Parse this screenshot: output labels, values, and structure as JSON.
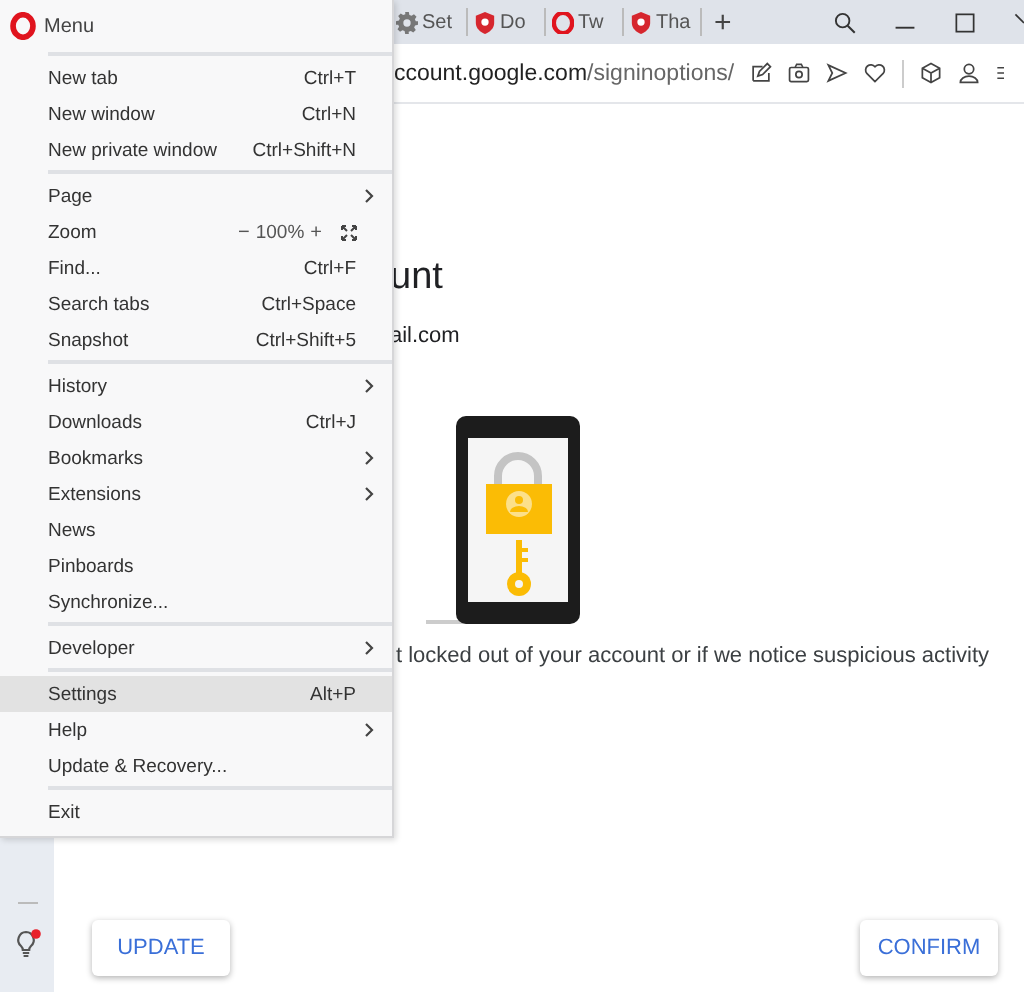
{
  "tabs": [
    {
      "kind": "gear",
      "label": "Set",
      "selected": false
    },
    {
      "kind": "shield",
      "label": "Do",
      "selected": false
    },
    {
      "kind": "opera",
      "label": "Tw",
      "selected": false
    },
    {
      "kind": "shield",
      "label": "Tha",
      "selected": false
    }
  ],
  "new_tab": "+",
  "address_bar": {
    "host": "ccount.google.com",
    "path": "/signinoptions/"
  },
  "page": {
    "heading": "unt",
    "email": "ail.com",
    "description": "t locked out of your account or if we notice suspicious activity",
    "buttons": [
      "UPDATE",
      "CONFIRM"
    ]
  },
  "sidebar": {
    "notification": true
  },
  "menu": {
    "title": "Menu",
    "groups": [
      [
        {
          "kind": "item",
          "label": "New tab",
          "shortcut": "Ctrl+T",
          "selected": false
        },
        {
          "kind": "item",
          "label": "New window",
          "shortcut": "Ctrl+N",
          "selected": false
        },
        {
          "kind": "item",
          "label": "New private window",
          "shortcut": "Ctrl+Shift+N",
          "selected": false
        }
      ],
      [
        {
          "kind": "submenu",
          "label": "Page",
          "selected": false
        },
        {
          "kind": "zoom",
          "label": "Zoom",
          "minus": "−",
          "value": "100%",
          "plus": "+",
          "selected": false
        },
        {
          "kind": "item",
          "label": "Find...",
          "shortcut": "Ctrl+F",
          "selected": false
        },
        {
          "kind": "item",
          "label": "Search tabs",
          "shortcut": "Ctrl+Space",
          "selected": false
        },
        {
          "kind": "item",
          "label": "Snapshot",
          "shortcut": "Ctrl+Shift+5",
          "selected": false
        }
      ],
      [
        {
          "kind": "submenu",
          "label": "History",
          "selected": false
        },
        {
          "kind": "item",
          "label": "Downloads",
          "shortcut": "Ctrl+J",
          "selected": false
        },
        {
          "kind": "submenu",
          "label": "Bookmarks",
          "selected": false
        },
        {
          "kind": "submenu",
          "label": "Extensions",
          "selected": false
        },
        {
          "kind": "item",
          "label": "News",
          "selected": false
        },
        {
          "kind": "item",
          "label": "Pinboards",
          "selected": false
        },
        {
          "kind": "item",
          "label": "Synchronize...",
          "selected": false
        }
      ],
      [
        {
          "kind": "submenu",
          "label": "Developer",
          "selected": false
        }
      ],
      [
        {
          "kind": "item",
          "label": "Settings",
          "shortcut": "Alt+P",
          "selected": true
        },
        {
          "kind": "submenu",
          "label": "Help",
          "selected": false
        },
        {
          "kind": "item",
          "label": "Update & Recovery...",
          "selected": false
        }
      ],
      [
        {
          "kind": "item",
          "label": "Exit",
          "selected": false
        }
      ]
    ]
  }
}
